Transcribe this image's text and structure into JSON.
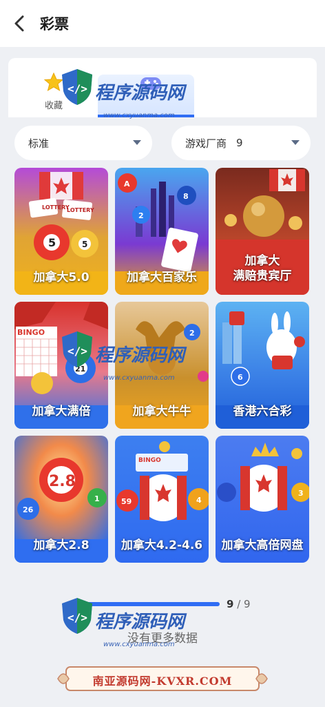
{
  "header": {
    "title": "彩票",
    "back_icon": "chevron-left-icon"
  },
  "favorites": {
    "label": "收藏",
    "icon": "star-icon",
    "active_tab_icon": "gamepad-icon"
  },
  "filters": {
    "sort_value": "标准",
    "vendor_label": "游戏厂商",
    "vendor_count": "9"
  },
  "games": [
    {
      "label": "加拿大5.0"
    },
    {
      "label": "加拿大百家乐"
    },
    {
      "label_line1": "加拿大",
      "label_line2": "满赔贵宾厅"
    },
    {
      "label": "加拿大满倍"
    },
    {
      "label": "加拿大牛牛"
    },
    {
      "label": "香港六合彩"
    },
    {
      "label": "加拿大2.8"
    },
    {
      "label": "加拿大4.2-4.6"
    },
    {
      "label": "加拿大高倍网盘"
    }
  ],
  "card_art": {
    "lottery_tag": "LOTTERY",
    "ball_5": "5",
    "ball_a": "A",
    "ball_2": "2",
    "ball_b": "8",
    "bingo_word": "BINGO",
    "ball_21": "21",
    "ball_2b": "2",
    "ball_6": "6",
    "ball_28": "2.8",
    "ball_26": "26",
    "ball_1": "1",
    "ball_59": "59",
    "ball_4": "4",
    "ball_3": "3"
  },
  "pagination": {
    "loaded": "9",
    "separator": " / ",
    "total": "9",
    "progress": 1.0
  },
  "status": {
    "no_more_text": "没有更多数据"
  },
  "footer": {
    "banner_text": "南亚源码网-KVXR.COM"
  },
  "watermark": {
    "brand": "程序源码网",
    "url": "www.cxyuanma.com"
  },
  "colors": {
    "accent": "#2f6df4",
    "card_gold": "#f5b319",
    "card_red": "#d83a3a",
    "card_blue": "#2d6ee8"
  }
}
